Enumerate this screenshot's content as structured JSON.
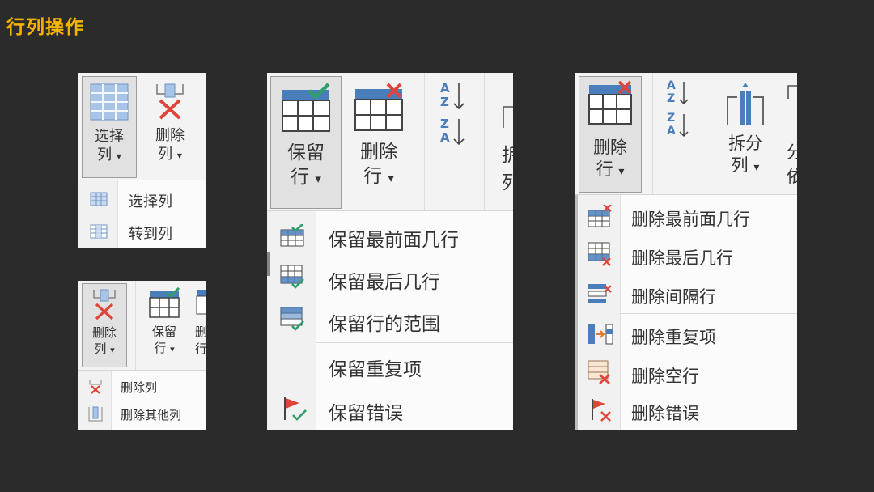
{
  "page": {
    "title": "行列操作"
  },
  "colors": {
    "title": "#f5b400",
    "background": "#2b2b2b",
    "grid_blue": "#4a7ebb",
    "check_green": "#2e9e6b",
    "delete_red": "#e0453a"
  },
  "panel_choose": {
    "button": {
      "line1": "选择",
      "line2": "列",
      "arrow": "▾",
      "icon": "table-grid-icon"
    },
    "delete_button": {
      "line1": "删除",
      "line2": "列",
      "arrow": "▾",
      "icon": "delete-column-icon"
    },
    "menu": [
      {
        "label": "选择列",
        "icon": "select-columns-icon"
      },
      {
        "label": "转到列",
        "icon": "goto-column-icon"
      }
    ]
  },
  "panel_delete_col": {
    "delete_button": {
      "line1": "删除",
      "line2": "列",
      "arrow": "▾",
      "icon": "delete-column-icon"
    },
    "keep_button": {
      "line1": "保留",
      "line2": "行",
      "arrow": "▾",
      "icon": "keep-rows-icon"
    },
    "clipped_button": {
      "line1": "删",
      "line2": "行"
    },
    "menu": [
      {
        "label": "删除列",
        "icon": "remove-column-icon"
      },
      {
        "label": "删除其他列",
        "icon": "remove-other-columns-icon"
      }
    ]
  },
  "panel_keep": {
    "keep_button": {
      "line1": "保留",
      "line2": "行",
      "arrow": "▾",
      "icon": "keep-rows-icon"
    },
    "delete_button": {
      "line1": "删除",
      "line2": "行",
      "arrow": "▾",
      "icon": "delete-rows-icon"
    },
    "sort_asc": {
      "top": "A",
      "bottom": "Z"
    },
    "sort_desc": {
      "top": "Z",
      "bottom": "A"
    },
    "clipped_label": {
      "line1": "拆",
      "line2": "列"
    },
    "menu": [
      {
        "label": "保留最前面几行",
        "icon": "keep-top-rows-icon"
      },
      {
        "label": "保留最后几行",
        "icon": "keep-bottom-rows-icon"
      },
      {
        "label": "保留行的范围",
        "icon": "keep-range-icon"
      },
      {
        "label": "保留重复项",
        "icon": ""
      },
      {
        "label": "保留错误",
        "icon": "keep-errors-icon"
      }
    ]
  },
  "panel_delete": {
    "delete_button": {
      "line1": "删除",
      "line2": "行",
      "arrow": "▾",
      "icon": "delete-rows-icon"
    },
    "sort_asc": {
      "top": "A",
      "bottom": "Z"
    },
    "sort_desc": {
      "top": "Z",
      "bottom": "A"
    },
    "split_button": {
      "line1": "拆分",
      "line2": "列",
      "arrow": "▾",
      "icon": "split-column-icon"
    },
    "clipped_label": {
      "line1": "分",
      "line2": "依"
    },
    "menu": [
      {
        "label": "删除最前面几行",
        "icon": "remove-top-rows-icon"
      },
      {
        "label": "删除最后几行",
        "icon": "remove-bottom-rows-icon"
      },
      {
        "label": "删除间隔行",
        "icon": "remove-alternate-rows-icon"
      },
      {
        "label": "删除重复项",
        "icon": "remove-duplicates-icon"
      },
      {
        "label": "删除空行",
        "icon": "remove-blank-rows-icon"
      },
      {
        "label": "删除错误",
        "icon": "remove-errors-icon"
      }
    ]
  }
}
